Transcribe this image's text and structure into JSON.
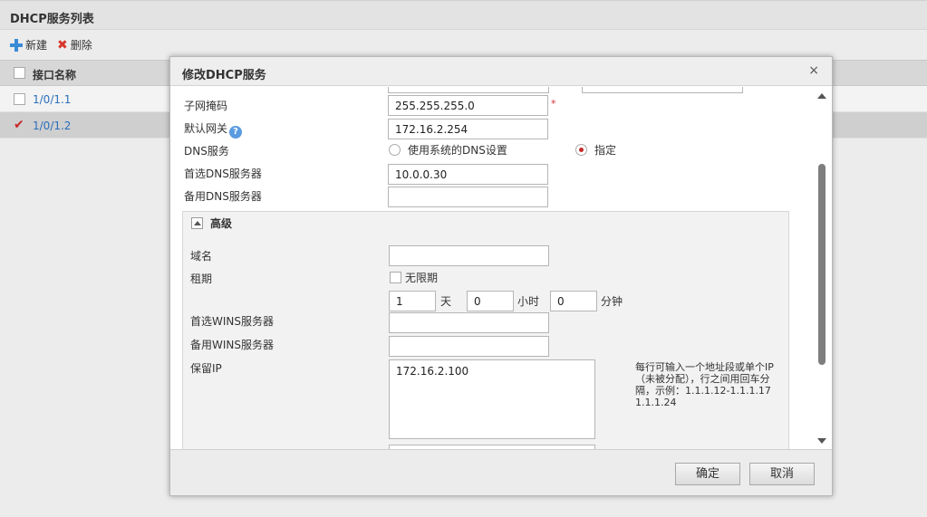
{
  "page": {
    "title": "DHCP服务列表",
    "toolbar": {
      "new_label": "新建",
      "delete_label": "删除"
    },
    "table": {
      "header": "接口名称",
      "rows": [
        {
          "name": "1/0/1.1",
          "checked": false
        },
        {
          "name": "1/0/1.2",
          "checked": true
        }
      ]
    }
  },
  "dialog": {
    "title": "修改DHCP服务",
    "close": "×",
    "fields": {
      "subnet_mask_label": "子网掩码",
      "subnet_mask_value": "255.255.255.0",
      "required_mark": "*",
      "gateway_label": "默认网关",
      "gateway_help": "?",
      "gateway_value": "172.16.2.254",
      "dns_label": "DNS服务",
      "dns_option_system": "使用系统的DNS设置",
      "dns_option_specify": "指定",
      "primary_dns_label": "首选DNS服务器",
      "primary_dns_value": "10.0.0.30",
      "secondary_dns_label": "备用DNS服务器",
      "secondary_dns_value": ""
    },
    "advanced": {
      "title": "高级",
      "domain_label": "域名",
      "domain_value": "",
      "lease_label": "租期",
      "unlimited_label": "无限期",
      "lease_days": "1",
      "days_unit": "天",
      "lease_hours": "0",
      "hours_unit": "小时",
      "lease_minutes": "0",
      "minutes_unit": "分钟",
      "primary_wins_label": "首选WINS服务器",
      "primary_wins_value": "",
      "secondary_wins_label": "备用WINS服务器",
      "secondary_wins_value": "",
      "reserved_ip_label": "保留IP",
      "reserved_ip_value": "172.16.2.100",
      "reserved_ip_hint": "每行可输入一个地址段或单个IP（未被分配），行之间用回车分隔，示例：1.1.1.12-1.1.1.17 1.1.1.24"
    },
    "buttons": {
      "ok": "确定",
      "cancel": "取消"
    }
  }
}
